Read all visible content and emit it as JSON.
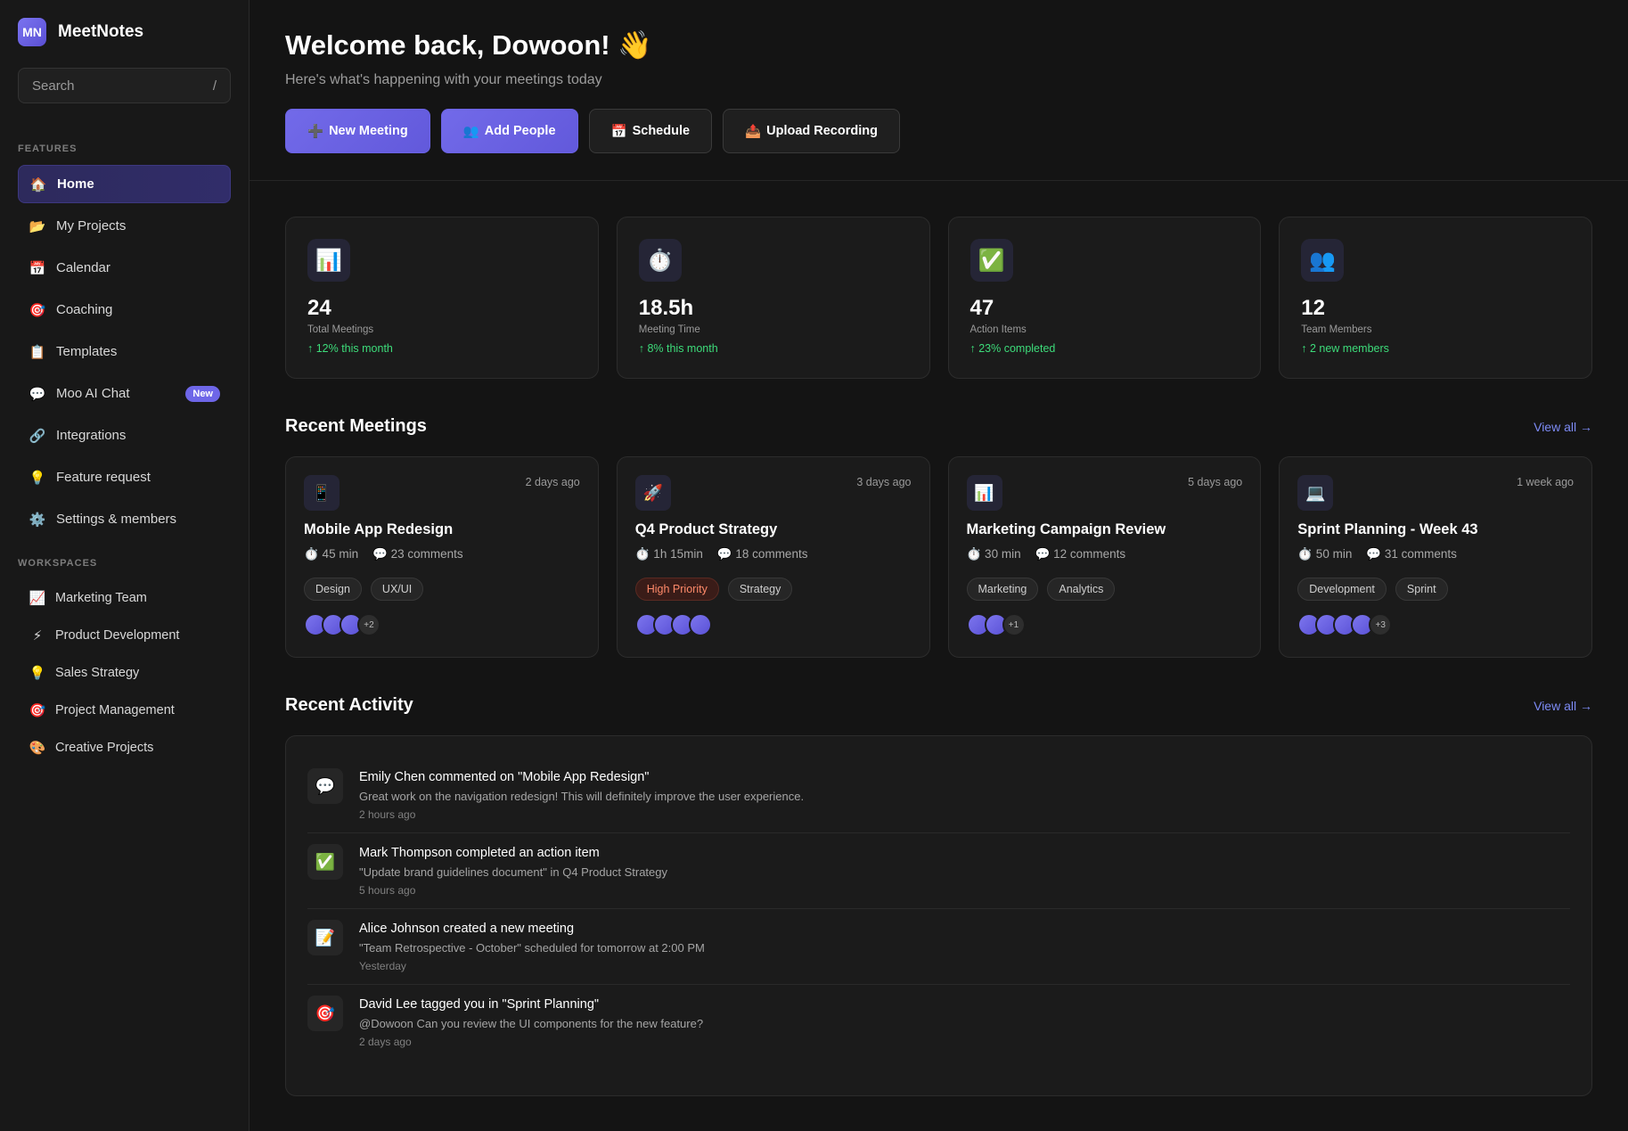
{
  "brand": {
    "logo": "MN",
    "name": "MeetNotes"
  },
  "search": {
    "placeholder": "Search",
    "shortcut": "/"
  },
  "sidebar": {
    "features_label": "FEATURES",
    "items": [
      {
        "icon": "🏠",
        "label": "Home"
      },
      {
        "icon": "📂",
        "label": "My Projects"
      },
      {
        "icon": "📅",
        "label": "Calendar"
      },
      {
        "icon": "🎯",
        "label": "Coaching"
      },
      {
        "icon": "📋",
        "label": "Templates"
      },
      {
        "icon": "💬",
        "label": "Moo AI Chat",
        "badge": "New"
      },
      {
        "icon": "🔗",
        "label": "Integrations"
      },
      {
        "icon": "💡",
        "label": "Feature request"
      },
      {
        "icon": "⚙️",
        "label": "Settings & members"
      }
    ],
    "workspaces_label": "WORKSPACES",
    "workspaces": [
      {
        "icon": "📈",
        "label": "Marketing Team"
      },
      {
        "icon": "⚡",
        "label": "Product Development"
      },
      {
        "icon": "💡",
        "label": "Sales Strategy"
      },
      {
        "icon": "🎯",
        "label": "Project Management"
      },
      {
        "icon": "🎨",
        "label": "Creative Projects"
      }
    ]
  },
  "header": {
    "welcome": "Welcome back, Dowoon! 👋",
    "subtitle": "Here's what's happening with your meetings today",
    "buttons": {
      "new_meeting": {
        "icon": "➕",
        "label": "New Meeting"
      },
      "add_people": {
        "icon": "👥",
        "label": "Add People"
      },
      "schedule": {
        "icon": "📅",
        "label": "Schedule"
      },
      "upload": {
        "icon": "📤",
        "label": "Upload Recording"
      }
    }
  },
  "stats": [
    {
      "icon": "📊",
      "value": "24",
      "label": "Total Meetings",
      "trend": "↑ 12% this month"
    },
    {
      "icon": "⏱️",
      "value": "18.5h",
      "label": "Meeting Time",
      "trend": "↑ 8% this month"
    },
    {
      "icon": "✅",
      "value": "47",
      "label": "Action Items",
      "trend": "↑ 23% completed"
    },
    {
      "icon": "👥",
      "value": "12",
      "label": "Team Members",
      "trend": "↑ 2 new members"
    }
  ],
  "recent_meetings": {
    "title": "Recent Meetings",
    "view_all": "View all →",
    "items": [
      {
        "icon": "📱",
        "time": "2 days ago",
        "title": "Mobile App Redesign",
        "duration": "⏱️ 45 min",
        "comments": "💬 23 comments",
        "tag1": "Design",
        "tag2": "UX/UI",
        "more": "+2"
      },
      {
        "icon": "🚀",
        "time": "3 days ago",
        "title": "Q4 Product Strategy",
        "duration": "⏱️ 1h 15min",
        "comments": "💬 18 comments",
        "tag1": "High Priority",
        "tag2": "Strategy",
        "more": ""
      },
      {
        "icon": "📊",
        "time": "5 days ago",
        "title": "Marketing Campaign Review",
        "duration": "⏱️ 30 min",
        "comments": "💬 12 comments",
        "tag1": "Marketing",
        "tag2": "Analytics",
        "more": "+1"
      },
      {
        "icon": "💻",
        "time": "1 week ago",
        "title": "Sprint Planning - Week 43",
        "duration": "⏱️ 50 min",
        "comments": "💬 31 comments",
        "tag1": "Development",
        "tag2": "Sprint",
        "more": "+3"
      }
    ]
  },
  "recent_activity": {
    "title": "Recent Activity",
    "view_all": "View all →",
    "items": [
      {
        "icon": "💬",
        "title": "Emily Chen commented on \"Mobile App Redesign\"",
        "desc": "Great work on the navigation redesign! This will definitely improve the user experience.",
        "time": "2 hours ago"
      },
      {
        "icon": "✅",
        "title": "Mark Thompson completed an action item",
        "desc": "\"Update brand guidelines document\" in Q4 Product Strategy",
        "time": "5 hours ago"
      },
      {
        "icon": "📝",
        "title": "Alice Johnson created a new meeting",
        "desc": "\"Team Retrospective - October\" scheduled for tomorrow at 2:00 PM",
        "time": "Yesterday"
      },
      {
        "icon": "🎯",
        "title": "David Lee tagged you in \"Sprint Planning\"",
        "desc": "@Dowoon Can you review the UI components for the new feature?",
        "time": "2 days ago"
      }
    ]
  },
  "colors": {
    "accent": "#6e66e8",
    "trend_green": "#3ddc7a",
    "link": "#7d8bf5",
    "background": "#141414"
  }
}
